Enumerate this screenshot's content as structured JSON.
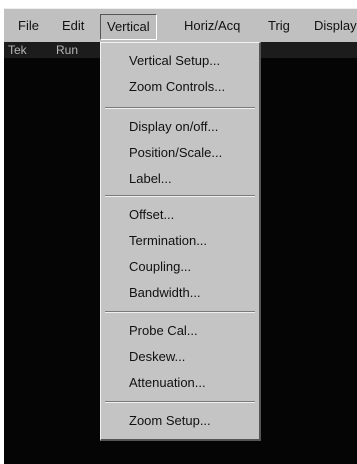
{
  "menubar": {
    "items": [
      {
        "label": "File"
      },
      {
        "label": "Edit"
      },
      {
        "label": "Vertical"
      },
      {
        "label": "Horiz/Acq"
      },
      {
        "label": "Trig"
      },
      {
        "label": "Display"
      }
    ],
    "active_item": "Vertical"
  },
  "status": {
    "brand": "Tek",
    "run_state": "Run"
  },
  "vertical_menu": {
    "items": [
      {
        "label": "Vertical Setup..."
      },
      {
        "label": "Zoom Controls..."
      },
      {
        "label": "Display on/off..."
      },
      {
        "label": "Position/Scale..."
      },
      {
        "label": "Label..."
      },
      {
        "label": "Offset..."
      },
      {
        "label": "Termination..."
      },
      {
        "label": "Coupling..."
      },
      {
        "label": "Bandwidth..."
      },
      {
        "label": "Probe Cal..."
      },
      {
        "label": "Deskew..."
      },
      {
        "label": "Attenuation..."
      },
      {
        "label": "Zoom Setup..."
      }
    ]
  }
}
